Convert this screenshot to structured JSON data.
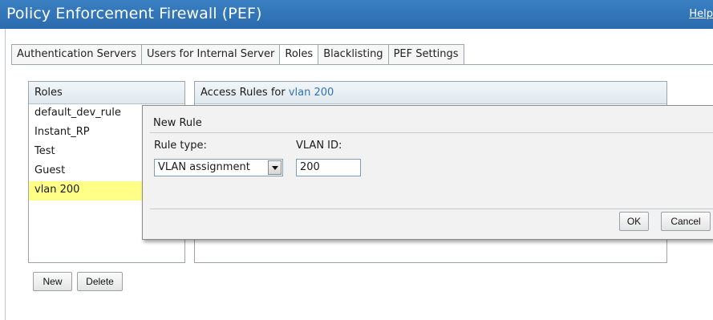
{
  "header": {
    "title": "Policy Enforcement Firewall (PEF)",
    "help_label": "Help"
  },
  "tabs": [
    {
      "label": "Authentication Servers",
      "active": false
    },
    {
      "label": "Users for Internal Server",
      "active": false
    },
    {
      "label": "Roles",
      "active": true
    },
    {
      "label": "Blacklisting",
      "active": false
    },
    {
      "label": "PEF Settings",
      "active": false
    }
  ],
  "roles_panel": {
    "header": "Roles",
    "items": [
      {
        "label": "default_dev_rule",
        "selected": false
      },
      {
        "label": "Instant_RP",
        "selected": false
      },
      {
        "label": "Test",
        "selected": false
      },
      {
        "label": "Guest",
        "selected": false
      },
      {
        "label": "vlan 200",
        "selected": true
      }
    ],
    "new_label": "New",
    "delete_label": "Delete"
  },
  "rules_panel": {
    "header_prefix": "Access Rules for",
    "role_name": "vlan 200"
  },
  "dialog": {
    "title": "New Rule",
    "rule_type_label": "Rule type:",
    "rule_type_value": "VLAN assignment",
    "vlan_id_label": "VLAN ID:",
    "vlan_id_value": "200",
    "ok_label": "OK",
    "cancel_label": "Cancel"
  },
  "colors": {
    "title_bar": "#2f72b8",
    "selected_row": "#ffff88",
    "role_link": "#2f74b5"
  }
}
